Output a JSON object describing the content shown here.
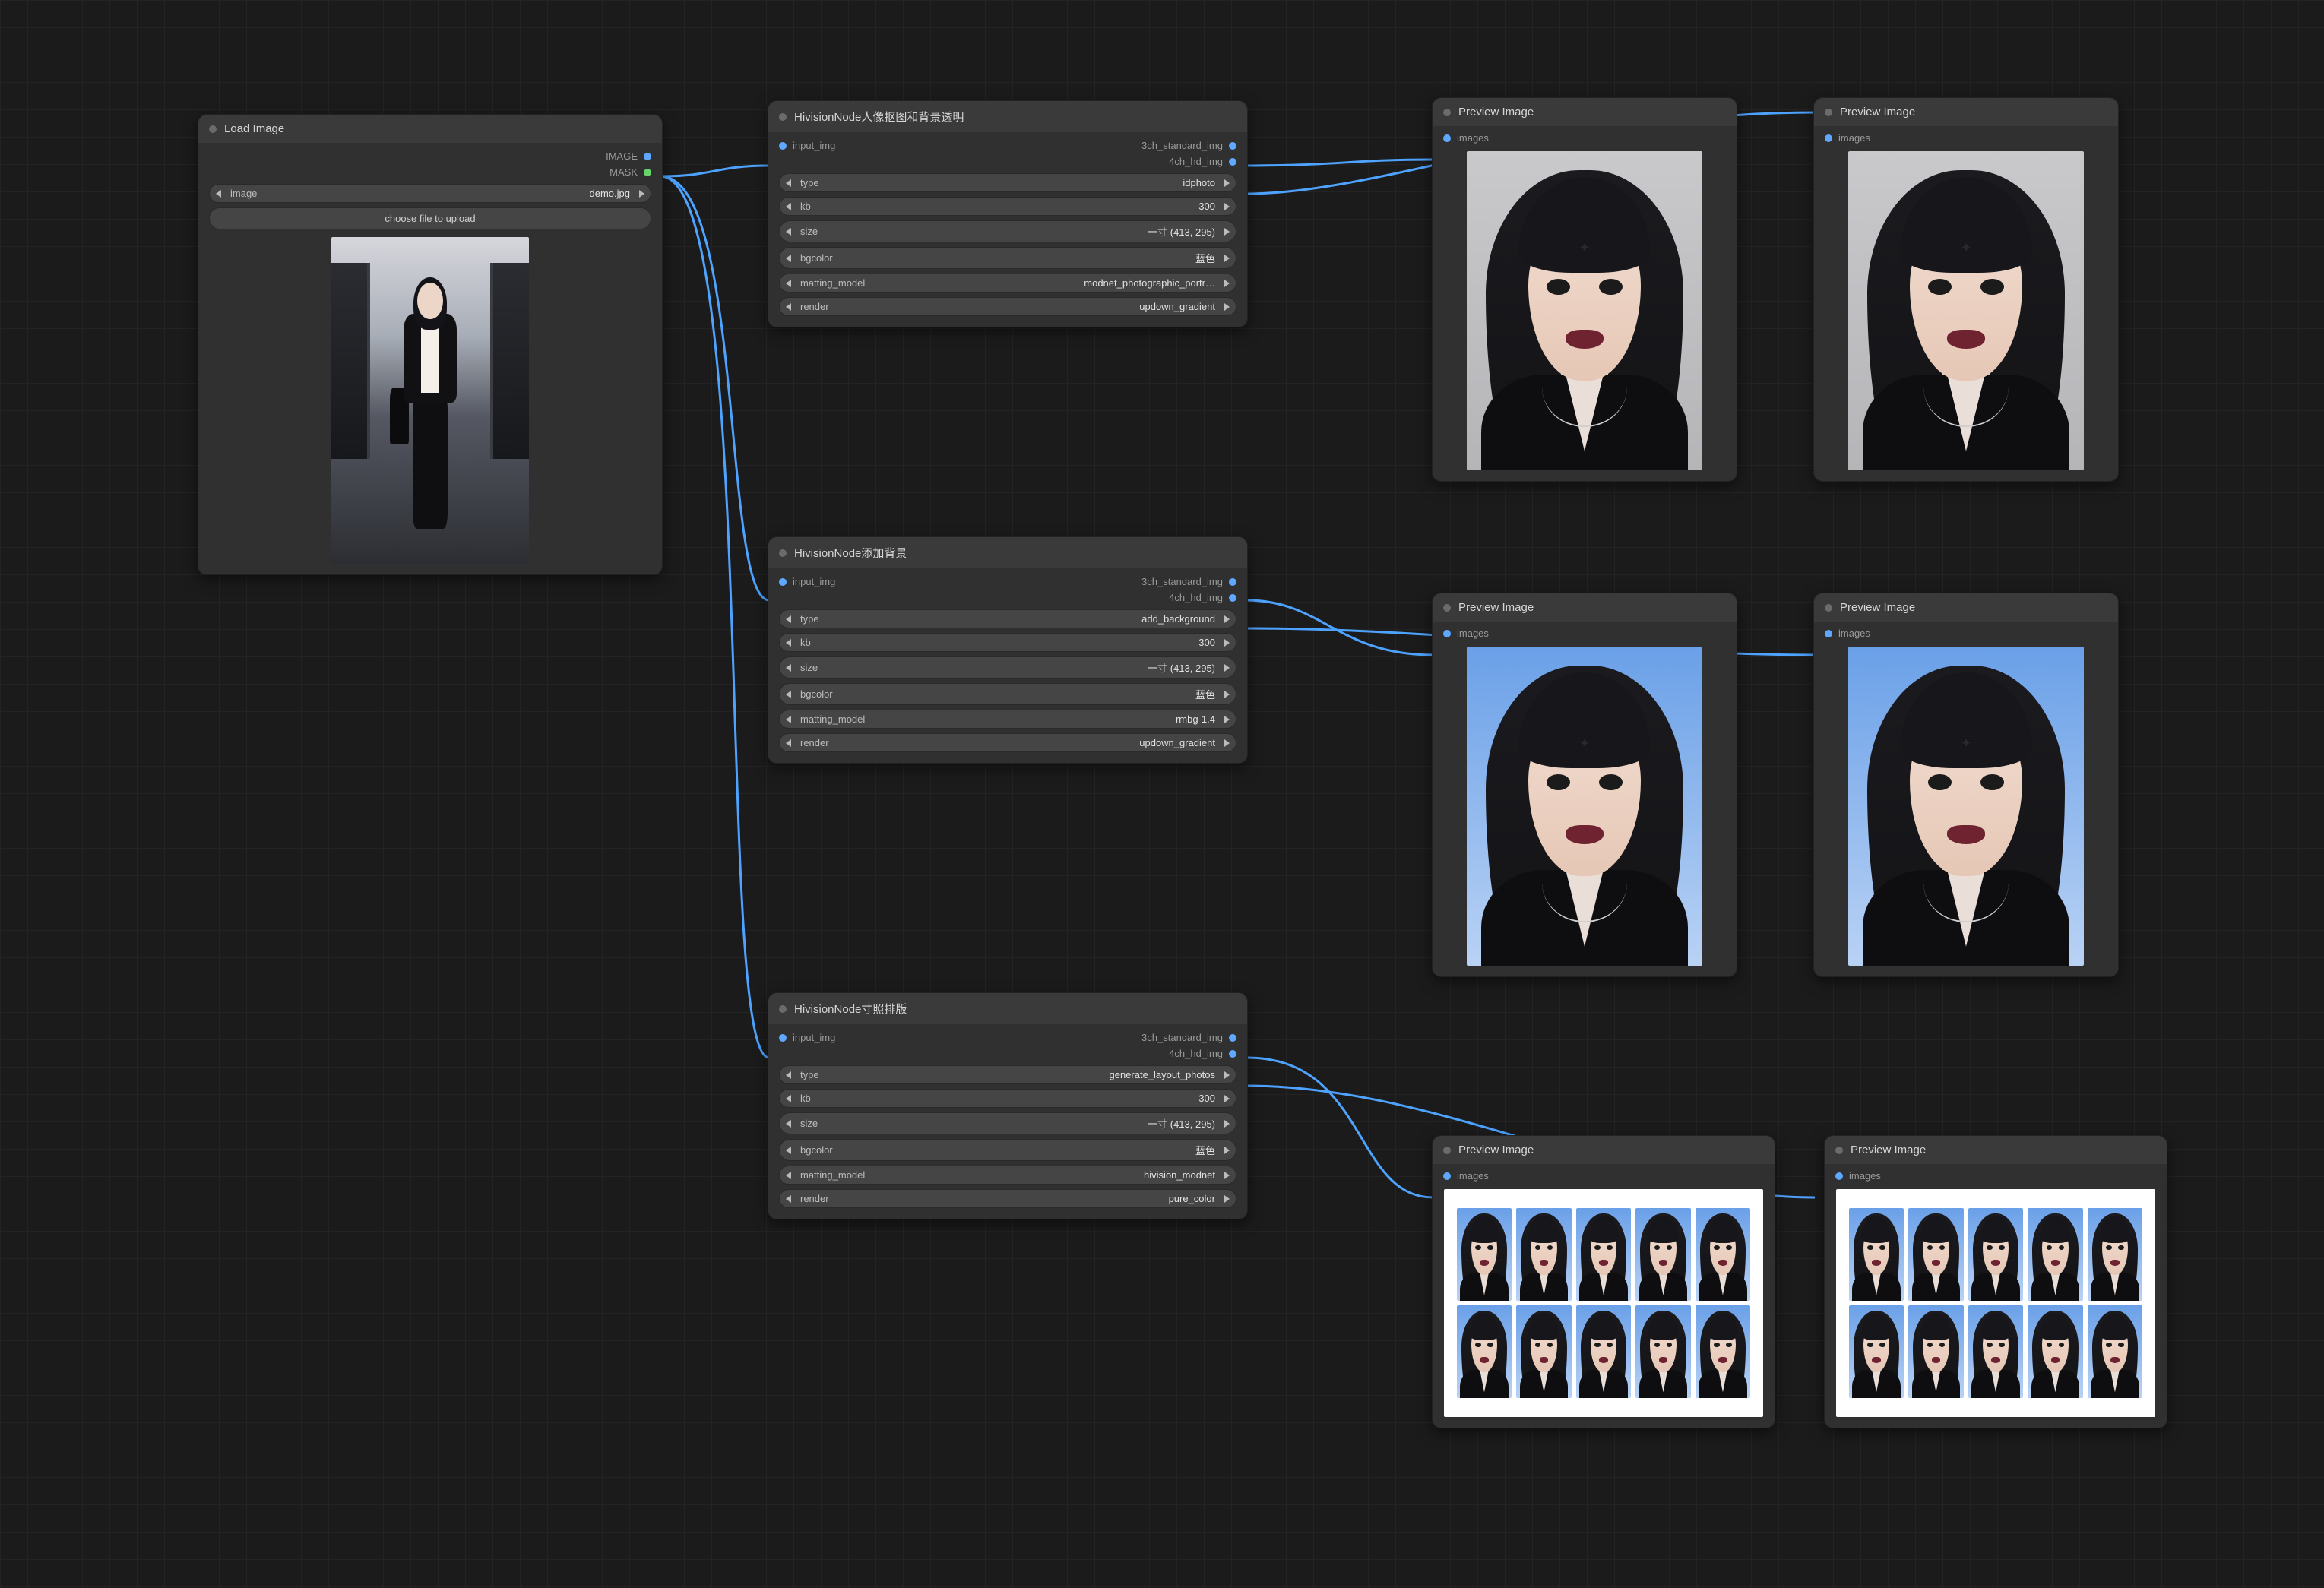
{
  "load_image": {
    "title": "Load Image",
    "out_image": "IMAGE",
    "out_mask": "MASK",
    "widget_image_label": "image",
    "widget_image_value": "demo.jpg",
    "upload_button": "choose file to upload"
  },
  "hivision1": {
    "title": "HivisionNode人像抠图和背景透明",
    "in_port": "input_img",
    "out_std": "3ch_standard_img",
    "out_hd": "4ch_hd_img",
    "params": [
      {
        "label": "type",
        "value": "idphoto"
      },
      {
        "label": "kb",
        "value": "300"
      },
      {
        "label": "size",
        "value": "一寸  (413, 295)"
      },
      {
        "label": "bgcolor",
        "value": "蓝色"
      },
      {
        "label": "matting_model",
        "value": "modnet_photographic_portr…"
      },
      {
        "label": "render",
        "value": "updown_gradient"
      }
    ]
  },
  "hivision2": {
    "title": "HivisionNode添加背景",
    "in_port": "input_img",
    "out_std": "3ch_standard_img",
    "out_hd": "4ch_hd_img",
    "params": [
      {
        "label": "type",
        "value": "add_background"
      },
      {
        "label": "kb",
        "value": "300"
      },
      {
        "label": "size",
        "value": "一寸  (413, 295)"
      },
      {
        "label": "bgcolor",
        "value": "蓝色"
      },
      {
        "label": "matting_model",
        "value": "rmbg-1.4"
      },
      {
        "label": "render",
        "value": "updown_gradient"
      }
    ]
  },
  "hivision3": {
    "title": "HivisionNode寸照排版",
    "in_port": "input_img",
    "out_std": "3ch_standard_img",
    "out_hd": "4ch_hd_img",
    "params": [
      {
        "label": "type",
        "value": "generate_layout_photos"
      },
      {
        "label": "kb",
        "value": "300"
      },
      {
        "label": "size",
        "value": "一寸  (413, 295)"
      },
      {
        "label": "bgcolor",
        "value": "蓝色"
      },
      {
        "label": "matting_model",
        "value": "hivision_modnet"
      },
      {
        "label": "render",
        "value": "pure_color"
      }
    ]
  },
  "preview_title": "Preview Image",
  "preview_in": "images"
}
